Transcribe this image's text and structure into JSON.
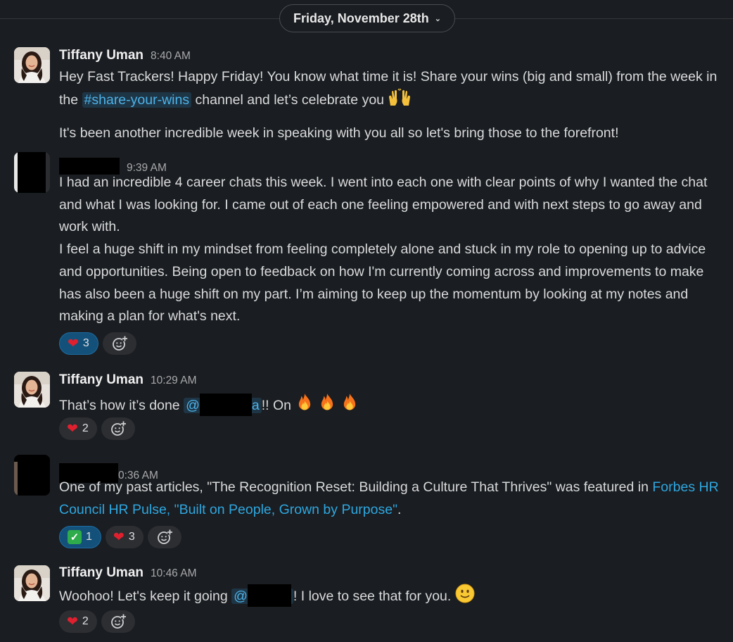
{
  "date_divider": {
    "label": "Friday, November 28th"
  },
  "messages": [
    {
      "author": "Tiffany Uman",
      "time": "8:40 AM",
      "p1_before": "Hey Fast Trackers! Happy Friday! You know what time it is! Share your wins (big and small) from the week in the ",
      "channel": "#share-your-wins",
      "p1_after": " channel and let’s celebrate you ",
      "p2": "It's been another incredible week in speaking with you all so let's bring those to the forefront!"
    },
    {
      "author": "",
      "time": "9:39 AM",
      "p1": "I had an incredible 4 career chats this week. I went into each one with clear points of why I wanted the chat and what I was looking for. I came out of each one feeling empowered and with next steps to go away and work with.",
      "p2": "I feel a huge shift in my mindset from feeling completely alone and stuck in my role to opening up to advice and opportunities. Being open to feedback on how I'm currently coming across and improvements to make has also been a huge shift on my part. I’m aiming to keep up the momentum by looking at my notes and making a plan for what's next.",
      "reactions": [
        {
          "emoji": "heart",
          "count": "3",
          "active": true
        }
      ]
    },
    {
      "author": "Tiffany Uman",
      "time": "10:29 AM",
      "before": "That’s how it’s done ",
      "mention_prefix": "@",
      "mention_suffix": "a",
      "after": "!! On ",
      "reactions": [
        {
          "emoji": "heart",
          "count": "2",
          "active": false
        }
      ]
    },
    {
      "author": "",
      "time": "0:36 AM",
      "before": "One of my past articles, \"The Recognition Reset: Building a Culture That Thrives\" was featured in ",
      "link": "Forbes HR Council HR Pulse, \"Built on People, Grown by Purpose\"",
      "after": ".",
      "reactions": [
        {
          "emoji": "check",
          "count": "1",
          "active": true
        },
        {
          "emoji": "heart",
          "count": "3",
          "active": false
        }
      ]
    },
    {
      "author": "Tiffany Uman",
      "time": "10:46 AM",
      "before": "Woohoo! Let's keep it going ",
      "mention_prefix": "@",
      "after": "! I love to see that for you. ",
      "reactions": [
        {
          "emoji": "heart",
          "count": "2",
          "active": false
        }
      ]
    }
  ],
  "icons": {
    "add_reaction": "add-reaction-icon",
    "raised_hands": "raised-hands-icon",
    "fire": "fire-icon",
    "smile": "smiling-face-icon"
  },
  "colors": {
    "background": "#1a1d21",
    "link": "#2ea7e0",
    "active_reaction": "#14517a"
  }
}
